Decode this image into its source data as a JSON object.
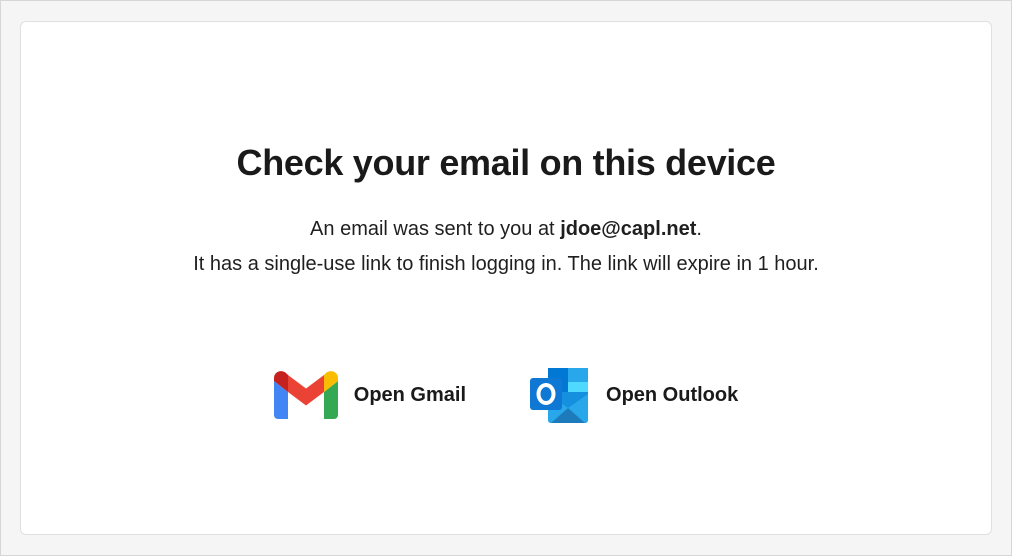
{
  "page": {
    "title": "Check your email on this device",
    "message": {
      "line1_prefix": "An email was sent to you at ",
      "email": "jdoe@capl.net",
      "line1_suffix": ".",
      "line2": "It has a single-use link to finish logging in. The link will expire in 1 hour."
    }
  },
  "apps": {
    "gmail": {
      "label": "Open Gmail",
      "icon": "gmail-icon"
    },
    "outlook": {
      "label": "Open Outlook",
      "icon": "outlook-icon"
    }
  },
  "colors": {
    "gmail_red": "#EA4335",
    "gmail_blue": "#4285F4",
    "gmail_green": "#34A853",
    "gmail_yellow": "#FBBC04",
    "gmail_darkred": "#C5221F",
    "outlook_blue": "#0364B8",
    "outlook_light": "#28A8EA"
  }
}
